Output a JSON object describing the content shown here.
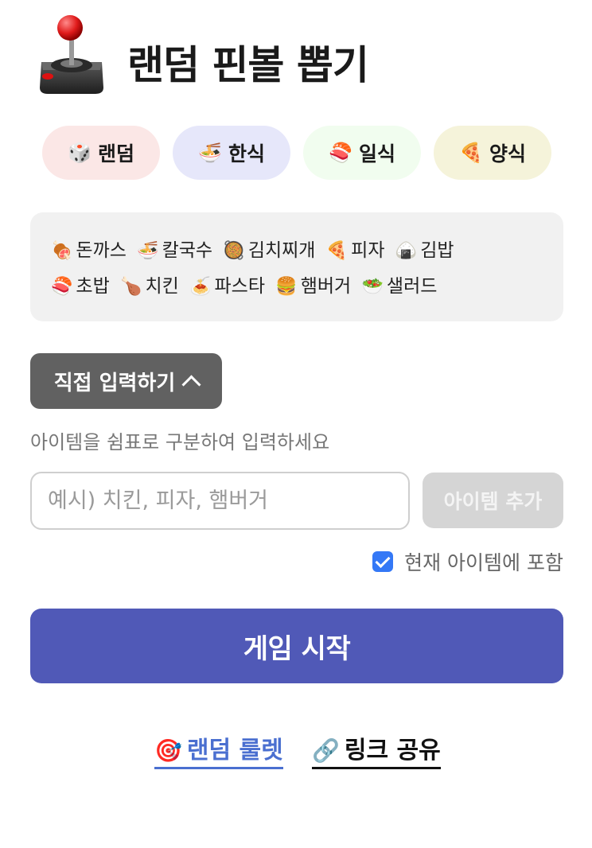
{
  "header": {
    "icon": "joystick-icon",
    "title": "랜덤 핀볼 뽑기"
  },
  "categories": [
    {
      "emoji": "🎲",
      "label": "랜덤",
      "color": "#fbe7e6"
    },
    {
      "emoji": "🍜",
      "label": "한식",
      "color": "#e6e7fa"
    },
    {
      "emoji": "🍣",
      "label": "일식",
      "color": "#f1fdef"
    },
    {
      "emoji": "🍕",
      "label": "양식",
      "color": "#f5f3da"
    }
  ],
  "items": [
    {
      "emoji": "🍖",
      "name": "돈까스"
    },
    {
      "emoji": "🍜",
      "name": "칼국수"
    },
    {
      "emoji": "🥘",
      "name": "김치찌개"
    },
    {
      "emoji": "🍕",
      "name": "피자"
    },
    {
      "emoji": "🍙",
      "name": "김밥"
    },
    {
      "emoji": "🍣",
      "name": "초밥"
    },
    {
      "emoji": "🍗",
      "name": "치킨"
    },
    {
      "emoji": "🍝",
      "name": "파스타"
    },
    {
      "emoji": "🍔",
      "name": "햄버거"
    },
    {
      "emoji": "🥗",
      "name": "샐러드"
    }
  ],
  "direct_input": {
    "toggle_label": "직접 입력하기",
    "hint": "아이템을 쉼표로 구분하여 입력하세요",
    "placeholder": "예시) 치킨, 피자, 햄버거",
    "value": "",
    "add_label": "아이템 추가",
    "include_label": "현재 아이템에 포함",
    "include_checked": true
  },
  "start_label": "게임 시작",
  "links": {
    "roulette": {
      "emoji": "🎯",
      "label": "랜덤 룰렛"
    },
    "share": {
      "emoji": "🔗",
      "label": "링크 공유"
    }
  },
  "colors": {
    "primary": "#5059b7",
    "link": "#4a6fd0",
    "checkbox": "#3478f6"
  }
}
